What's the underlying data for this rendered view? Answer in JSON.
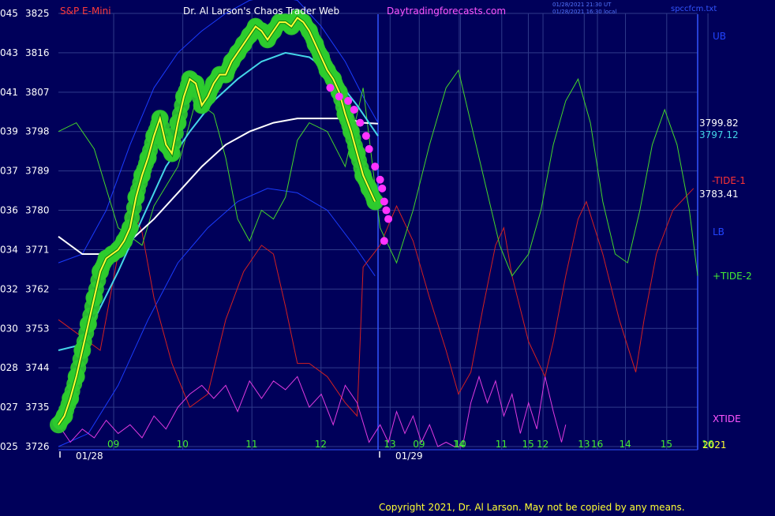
{
  "header": {
    "symbol": "S&P E-Mini",
    "site_title": "Dr. Al Larson's Chaos Trader Web",
    "site_url": "Daytradingforecasts.com",
    "stamp_line1": "01/28/2021 21:30 UT",
    "stamp_line2": "01/28/2021 16:30 local",
    "file_name": "spccfcm.txt"
  },
  "footer": {
    "copyright": "Copyright 2021, Dr. Al Larson. May not be copied by any means."
  },
  "colors": {
    "background": "#00005a",
    "grid": "#2f3a8a",
    "price_dots": "#2ecc2e",
    "price_line": "#ffff33",
    "ma_fast": "#44d6e8",
    "ma_slow": "#ffffff",
    "band": "#1a3cff",
    "tide_minus": "#d42020",
    "tide_plus": "#44d62a",
    "xtide": "#e03ae0",
    "overlay_dots": "#ff33ff"
  },
  "chart_data": {
    "type": "line",
    "title": "",
    "xlabel": "",
    "ylabel": "",
    "ylim": [
      3726,
      3825
    ],
    "y_ticks_price": [
      "3825",
      "3816",
      "3807",
      "3798",
      "3789",
      "3780",
      "3771",
      "3762",
      "3753",
      "3744",
      "3735",
      "3726"
    ],
    "y_ticks_code": [
      "045",
      "043",
      "041",
      "039",
      "037",
      "036",
      "034",
      "032",
      "030",
      "028",
      "027",
      "025"
    ],
    "x_range": [
      8.2,
      17.45
    ],
    "x_ticks": [
      {
        "x": 9,
        "label": "09"
      },
      {
        "x": 10,
        "label": "10"
      },
      {
        "x": 11,
        "label": "11"
      },
      {
        "x": 12,
        "label": "12"
      },
      {
        "x": 13,
        "label": "13"
      },
      {
        "x": 14,
        "label": "14"
      },
      {
        "x": 15,
        "label": "15"
      },
      {
        "x": 16,
        "label": "16"
      },
      {
        "x": 17,
        "label": "09"
      },
      {
        "x": 18,
        "label": "10"
      },
      {
        "x": 19,
        "label": "11"
      },
      {
        "x": 20,
        "label": "12"
      },
      {
        "x": 21,
        "label": "13"
      },
      {
        "x": 22,
        "label": "14"
      },
      {
        "x": 23,
        "label": "15"
      },
      {
        "x": 24,
        "label": "16"
      }
    ],
    "date_labels": [
      {
        "x": 9,
        "label": "01/28"
      },
      {
        "x": 17,
        "label": "01/29"
      }
    ],
    "year_label": "2021",
    "right_labels": {
      "ub": "UB",
      "lb": "LB",
      "tide_minus": "-TIDE-1",
      "tide_plus": "+TIDE-2",
      "xtide": "XTIDE",
      "ma_slow_value": "3799.82",
      "ma_fast_value": "3797.12",
      "last_value": "3783.41"
    },
    "series": [
      {
        "key": "price",
        "values": [
          [
            8.0,
            3731
          ],
          [
            8.1,
            3733
          ],
          [
            8.2,
            3737
          ],
          [
            8.3,
            3742
          ],
          [
            8.4,
            3748
          ],
          [
            8.5,
            3754
          ],
          [
            8.6,
            3760
          ],
          [
            8.7,
            3766
          ],
          [
            8.8,
            3769
          ],
          [
            8.9,
            3770
          ],
          [
            9.0,
            3771
          ],
          [
            9.1,
            3773
          ],
          [
            9.2,
            3776
          ],
          [
            9.3,
            3783
          ],
          [
            9.4,
            3788
          ],
          [
            9.5,
            3792
          ],
          [
            9.6,
            3797
          ],
          [
            9.7,
            3801
          ],
          [
            9.8,
            3795
          ],
          [
            9.9,
            3793
          ],
          [
            10.0,
            3800
          ],
          [
            10.1,
            3806
          ],
          [
            10.2,
            3810
          ],
          [
            10.3,
            3809
          ],
          [
            10.4,
            3804
          ],
          [
            10.5,
            3806
          ],
          [
            10.6,
            3809
          ],
          [
            10.7,
            3811
          ],
          [
            10.8,
            3811
          ],
          [
            10.9,
            3814
          ],
          [
            11.0,
            3816
          ],
          [
            11.1,
            3818
          ],
          [
            11.2,
            3820
          ],
          [
            11.3,
            3822
          ],
          [
            11.4,
            3821
          ],
          [
            11.5,
            3819
          ],
          [
            11.6,
            3821
          ],
          [
            11.7,
            3823
          ],
          [
            11.8,
            3823
          ],
          [
            11.9,
            3822
          ],
          [
            12.0,
            3824
          ],
          [
            12.1,
            3823
          ],
          [
            12.2,
            3821
          ],
          [
            12.3,
            3818
          ],
          [
            12.4,
            3815
          ],
          [
            12.5,
            3812
          ],
          [
            12.6,
            3810
          ],
          [
            12.7,
            3807
          ],
          [
            12.8,
            3802
          ],
          [
            12.9,
            3798
          ],
          [
            13.0,
            3793
          ],
          [
            13.1,
            3788
          ],
          [
            13.2,
            3785
          ],
          [
            13.3,
            3782
          ]
        ]
      },
      {
        "key": "ma_fast",
        "values": [
          [
            8.0,
            3748
          ],
          [
            8.3,
            3749
          ],
          [
            8.6,
            3755
          ],
          [
            9.0,
            3766
          ],
          [
            9.4,
            3778
          ],
          [
            9.8,
            3790
          ],
          [
            10.2,
            3798
          ],
          [
            10.6,
            3805
          ],
          [
            11.0,
            3810
          ],
          [
            11.4,
            3814
          ],
          [
            11.8,
            3816
          ],
          [
            12.2,
            3815
          ],
          [
            12.6,
            3811
          ],
          [
            13.0,
            3804
          ],
          [
            13.35,
            3797
          ]
        ]
      },
      {
        "key": "ma_slow",
        "values": [
          [
            8.0,
            3774
          ],
          [
            8.4,
            3770
          ],
          [
            8.8,
            3770
          ],
          [
            9.2,
            3773
          ],
          [
            9.6,
            3778
          ],
          [
            10.0,
            3784
          ],
          [
            10.4,
            3790
          ],
          [
            10.8,
            3795
          ],
          [
            11.2,
            3798
          ],
          [
            11.6,
            3800
          ],
          [
            12.0,
            3801
          ],
          [
            12.4,
            3801
          ],
          [
            12.8,
            3801
          ],
          [
            13.1,
            3800
          ],
          [
            13.35,
            3799.8
          ]
        ]
      },
      {
        "key": "band_upper",
        "values": [
          [
            8.0,
            3768
          ],
          [
            8.4,
            3770
          ],
          [
            8.8,
            3780
          ],
          [
            9.2,
            3795
          ],
          [
            9.6,
            3808
          ],
          [
            10.0,
            3816
          ],
          [
            10.4,
            3821
          ],
          [
            10.8,
            3825
          ],
          [
            11.2,
            3828
          ],
          [
            11.6,
            3829
          ],
          [
            12.0,
            3828
          ],
          [
            12.4,
            3822
          ],
          [
            12.8,
            3814
          ],
          [
            13.1,
            3806
          ],
          [
            13.35,
            3800
          ]
        ]
      },
      {
        "key": "band_lower",
        "values": [
          [
            8.0,
            3726
          ],
          [
            8.5,
            3729
          ],
          [
            9.0,
            3740
          ],
          [
            9.5,
            3755
          ],
          [
            10.0,
            3768
          ],
          [
            10.5,
            3776
          ],
          [
            11.0,
            3782
          ],
          [
            11.5,
            3785
          ],
          [
            12.0,
            3784
          ],
          [
            12.5,
            3780
          ],
          [
            13.0,
            3771
          ],
          [
            13.3,
            3765
          ]
        ]
      },
      {
        "key": "tide_minus",
        "values": [
          [
            8.0,
            3755
          ],
          [
            8.3,
            3752
          ],
          [
            8.7,
            3748
          ],
          [
            9.0,
            3770
          ],
          [
            9.2,
            3782
          ],
          [
            9.4,
            3775
          ],
          [
            9.6,
            3760
          ],
          [
            9.9,
            3745
          ],
          [
            10.2,
            3735
          ],
          [
            10.5,
            3738
          ],
          [
            10.8,
            3755
          ],
          [
            11.1,
            3766
          ],
          [
            11.4,
            3772
          ],
          [
            11.6,
            3770
          ],
          [
            11.8,
            3758
          ],
          [
            12.0,
            3745
          ],
          [
            12.2,
            3745
          ],
          [
            12.5,
            3742
          ],
          [
            12.8,
            3736
          ],
          [
            13.0,
            3733
          ],
          [
            13.1,
            3767
          ],
          [
            13.4,
            3772
          ],
          [
            13.8,
            3781
          ],
          [
            14.2,
            3773
          ],
          [
            14.6,
            3760
          ],
          [
            15.0,
            3748
          ],
          [
            15.3,
            3738
          ],
          [
            15.6,
            3743
          ],
          [
            15.9,
            3758
          ],
          [
            16.2,
            3772
          ],
          [
            16.4,
            3776
          ],
          [
            16.6,
            3765
          ],
          [
            17.0,
            3750
          ],
          [
            17.4,
            3742
          ],
          [
            17.6,
            3750
          ],
          [
            17.9,
            3765
          ],
          [
            18.2,
            3778
          ],
          [
            18.4,
            3782
          ],
          [
            18.8,
            3770
          ],
          [
            19.2,
            3755
          ],
          [
            19.6,
            3743
          ],
          [
            19.8,
            3755
          ],
          [
            20.1,
            3770
          ],
          [
            20.5,
            3780
          ],
          [
            21.0,
            3785
          ]
        ]
      },
      {
        "key": "tide_plus",
        "values": [
          [
            8.0,
            3798
          ],
          [
            8.3,
            3800
          ],
          [
            8.6,
            3794
          ],
          [
            9.0,
            3776
          ],
          [
            9.4,
            3772
          ],
          [
            9.6,
            3781
          ],
          [
            10.0,
            3790
          ],
          [
            10.3,
            3805
          ],
          [
            10.6,
            3802
          ],
          [
            10.8,
            3792
          ],
          [
            11.0,
            3778
          ],
          [
            11.2,
            3773
          ],
          [
            11.4,
            3780
          ],
          [
            11.6,
            3778
          ],
          [
            11.8,
            3783
          ],
          [
            12.0,
            3796
          ],
          [
            12.2,
            3800
          ],
          [
            12.5,
            3798
          ],
          [
            12.8,
            3790
          ],
          [
            13.1,
            3808
          ],
          [
            13.4,
            3776
          ],
          [
            13.8,
            3768
          ],
          [
            14.2,
            3780
          ],
          [
            14.6,
            3795
          ],
          [
            15.0,
            3808
          ],
          [
            15.3,
            3812
          ],
          [
            15.6,
            3800
          ],
          [
            16.0,
            3784
          ],
          [
            16.3,
            3772
          ],
          [
            16.6,
            3765
          ],
          [
            17.0,
            3770
          ],
          [
            17.3,
            3780
          ],
          [
            17.6,
            3795
          ],
          [
            17.9,
            3805
          ],
          [
            18.2,
            3810
          ],
          [
            18.5,
            3800
          ],
          [
            18.8,
            3782
          ],
          [
            19.1,
            3770
          ],
          [
            19.4,
            3768
          ],
          [
            19.7,
            3780
          ],
          [
            20.0,
            3795
          ],
          [
            20.3,
            3803
          ],
          [
            20.6,
            3795
          ],
          [
            20.9,
            3780
          ],
          [
            21.1,
            3765
          ]
        ]
      },
      {
        "key": "xtide",
        "values": [
          [
            8.0,
            3731
          ],
          [
            8.2,
            3727
          ],
          [
            8.4,
            3730
          ],
          [
            8.6,
            3728
          ],
          [
            8.8,
            3732
          ],
          [
            9.0,
            3729
          ],
          [
            9.2,
            3731
          ],
          [
            9.4,
            3728
          ],
          [
            9.6,
            3733
          ],
          [
            9.8,
            3730
          ],
          [
            10.0,
            3735
          ],
          [
            10.2,
            3738
          ],
          [
            10.4,
            3740
          ],
          [
            10.6,
            3737
          ],
          [
            10.8,
            3740
          ],
          [
            11.0,
            3734
          ],
          [
            11.2,
            3741
          ],
          [
            11.4,
            3737
          ],
          [
            11.6,
            3741
          ],
          [
            11.8,
            3739
          ],
          [
            12.0,
            3742
          ],
          [
            12.2,
            3735
          ],
          [
            12.4,
            3738
          ],
          [
            12.6,
            3731
          ],
          [
            12.8,
            3740
          ],
          [
            13.0,
            3736
          ],
          [
            13.2,
            3727
          ],
          [
            13.4,
            3731
          ],
          [
            13.6,
            3727
          ],
          [
            13.8,
            3734
          ],
          [
            14.0,
            3729
          ],
          [
            14.2,
            3733
          ],
          [
            14.4,
            3727
          ],
          [
            14.6,
            3731
          ],
          [
            14.8,
            3726
          ],
          [
            15.0,
            3727
          ],
          [
            15.2,
            3726
          ],
          [
            15.4,
            3726
          ],
          [
            15.6,
            3736
          ],
          [
            15.8,
            3742
          ],
          [
            16.0,
            3736
          ],
          [
            16.2,
            3741
          ],
          [
            16.4,
            3733
          ],
          [
            16.6,
            3738
          ],
          [
            16.8,
            3729
          ],
          [
            17.0,
            3736
          ],
          [
            17.2,
            3730
          ],
          [
            17.4,
            3742
          ],
          [
            17.6,
            3734
          ],
          [
            17.8,
            3727
          ],
          [
            17.9,
            3731
          ]
        ]
      }
    ],
    "overlay_dots": [
      [
        12.55,
        3808
      ],
      [
        12.7,
        3806
      ],
      [
        12.85,
        3805
      ],
      [
        12.95,
        3803
      ],
      [
        13.05,
        3800
      ],
      [
        13.15,
        3797
      ],
      [
        13.2,
        3794
      ],
      [
        13.3,
        3790
      ],
      [
        13.4,
        3787
      ],
      [
        13.45,
        3785
      ],
      [
        13.5,
        3782
      ],
      [
        13.55,
        3780
      ],
      [
        13.6,
        3778
      ],
      [
        13.5,
        3773
      ]
    ]
  }
}
